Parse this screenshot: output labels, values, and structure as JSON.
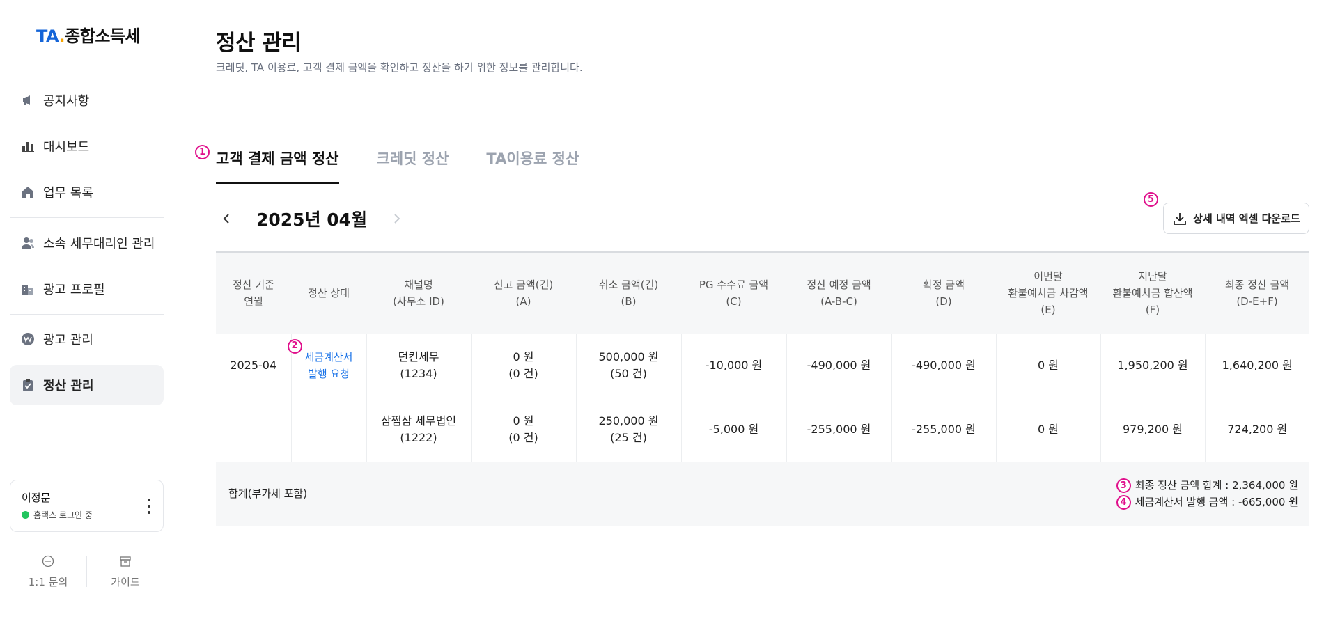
{
  "logo": {
    "ta": "TA",
    "dot": ".",
    "rest": "종합소득세"
  },
  "sidebar": {
    "items": [
      {
        "label": "공지사항",
        "icon": "megaphone-icon"
      },
      {
        "label": "대시보드",
        "icon": "bar-chart-icon"
      },
      {
        "label": "업무 목록",
        "icon": "home-icon"
      },
      {
        "label": "소속 세무대리인 관리",
        "icon": "users-icon"
      },
      {
        "label": "광고 프로필",
        "icon": "building-icon"
      },
      {
        "label": "광고 관리",
        "icon": "won-icon"
      },
      {
        "label": "정산 관리",
        "icon": "clipboard-icon",
        "active": true
      }
    ],
    "user": {
      "name": "이정문",
      "status": "홈택스 로그인 중"
    },
    "bottom": {
      "inquiry": "1:1 문의",
      "guide": "가이드"
    }
  },
  "header": {
    "title": "정산 관리",
    "description": "크레딧, TA 이용료, 고객 결제 금액을 확인하고 정산을 하기 위한 정보를 관리합니다."
  },
  "markers": [
    "1",
    "2",
    "3",
    "4",
    "5"
  ],
  "tabs": [
    "고객 결제 금액 정산",
    "크레딧 정산",
    "TA이용료 정산"
  ],
  "month": "2025년 04월",
  "excel_button": "상세 내역 엑셀 다운로드",
  "table": {
    "headers": [
      [
        "정산 기준",
        "연월"
      ],
      [
        "정산 상태"
      ],
      [
        "채널명",
        "(사무소 ID)"
      ],
      [
        "신고 금액(건)",
        "(A)"
      ],
      [
        "취소 금액(건)",
        "(B)"
      ],
      [
        "PG 수수료 금액",
        "(C)"
      ],
      [
        "정산 예정 금액",
        "(A-B-C)"
      ],
      [
        "확정 금액",
        "(D)"
      ],
      [
        "이번달",
        "환불예치금 차감액",
        "(E)"
      ],
      [
        "지난달",
        "환불예치금 합산액",
        "(F)"
      ],
      [
        "최종 정산 금액",
        "(D-E+F)"
      ]
    ],
    "period": "2025-04",
    "status": [
      "세금계산서",
      "발행 요청"
    ],
    "rows": [
      {
        "channel": [
          "던킨세무",
          "(1234)"
        ],
        "report": [
          "0 원",
          "(0 건)"
        ],
        "cancel": [
          "500,000 원",
          "(50 건)"
        ],
        "pg_fee": "-10,000 원",
        "expected": "-490,000 원",
        "confirmed": "-490,000 원",
        "refund_deduct": "0 원",
        "refund_sum": "1,950,200 원",
        "final": "1,640,200 원"
      },
      {
        "channel": [
          "삼쩜삼 세무법인",
          "(1222)"
        ],
        "report": [
          "0 원",
          "(0 건)"
        ],
        "cancel": [
          "250,000 원",
          "(25 건)"
        ],
        "pg_fee": "-5,000 원",
        "expected": "-255,000 원",
        "confirmed": "-255,000 원",
        "refund_deduct": "0 원",
        "refund_sum": "979,200 원",
        "final": "724,200 원"
      }
    ],
    "total": {
      "label": "합계(부가세 포함)",
      "final_total": "최종 정산 금액 합계 : 2,364,000 원",
      "invoice_total": "세금계산서 발행 금액 : -665,000 원"
    }
  }
}
